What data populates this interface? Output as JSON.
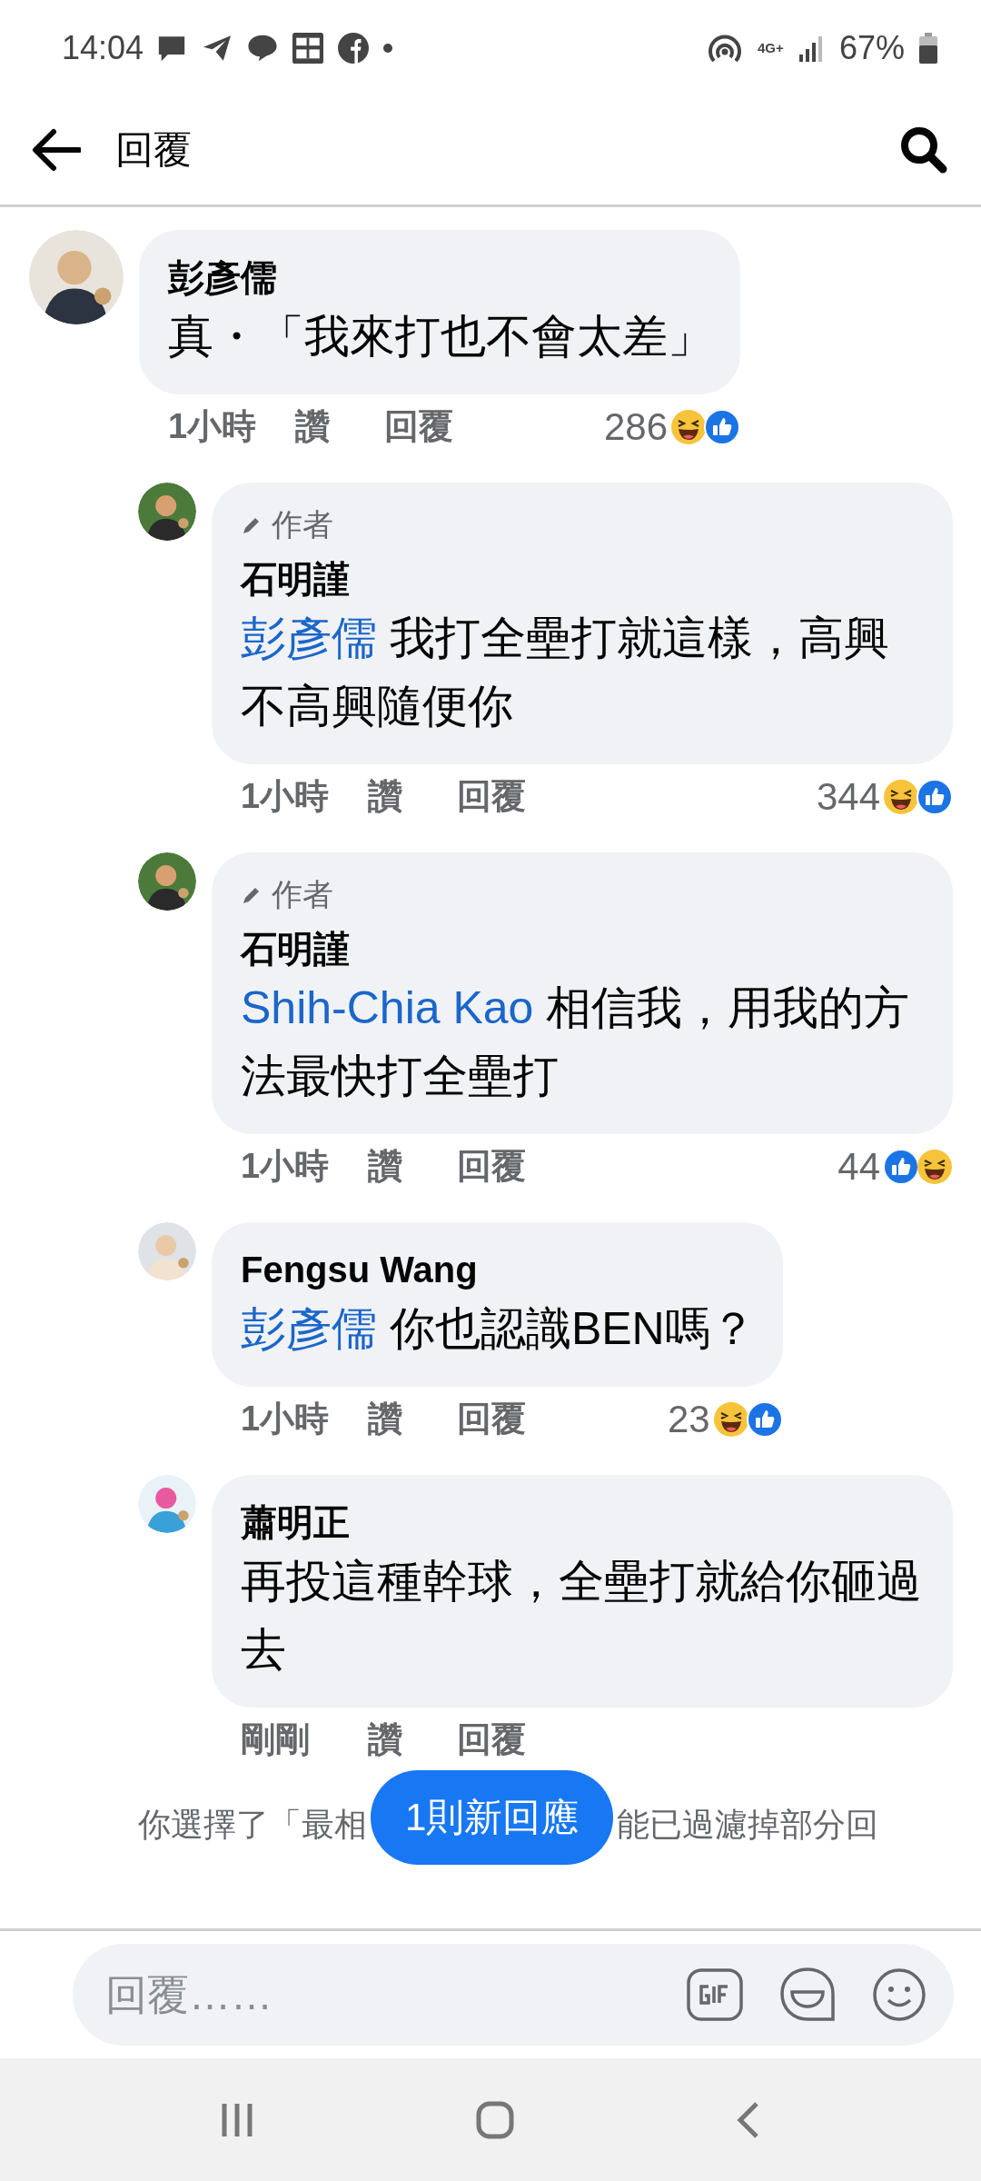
{
  "status_bar": {
    "time": "14:04",
    "network": "4G+",
    "battery": "67%"
  },
  "header": {
    "title": "回覆"
  },
  "comments": [
    {
      "author": "彭彥儒",
      "text": "真・「我來打也不會太差」",
      "time": "1小時",
      "like": "讚",
      "reply": "回覆",
      "reaction_count": "286",
      "like_first": false,
      "children": [
        {
          "author": "石明謹",
          "author_label": "作者",
          "mention": "彭彥儒",
          "text": "我打全壘打就這樣，高興不高興隨便你",
          "time": "1小時",
          "like": "讚",
          "reply": "回覆",
          "reaction_count": "344",
          "like_first": false
        },
        {
          "author": "石明謹",
          "author_label": "作者",
          "mention": "Shih-Chia Kao",
          "text": "相信我，用我的方法最快打全壘打",
          "time": "1小時",
          "like": "讚",
          "reply": "回覆",
          "reaction_count": "44",
          "like_first": true
        },
        {
          "author": "Fengsu Wang",
          "mention": "彭彥儒",
          "text": "你也認識BEN嗎？",
          "time": "1小時",
          "like": "讚",
          "reply": "回覆",
          "reaction_count": "23",
          "like_first": false
        },
        {
          "author": "蕭明正",
          "text": "再投這種幹球，全壘打就給你砸過去",
          "time": "剛剛",
          "like": "讚",
          "reply": "回覆"
        }
      ]
    }
  ],
  "notice": {
    "left": "你選擇了「最相",
    "right": "能已過濾掉部分回"
  },
  "new_replies_button": "1則新回應",
  "composer": {
    "placeholder": "回覆……"
  }
}
